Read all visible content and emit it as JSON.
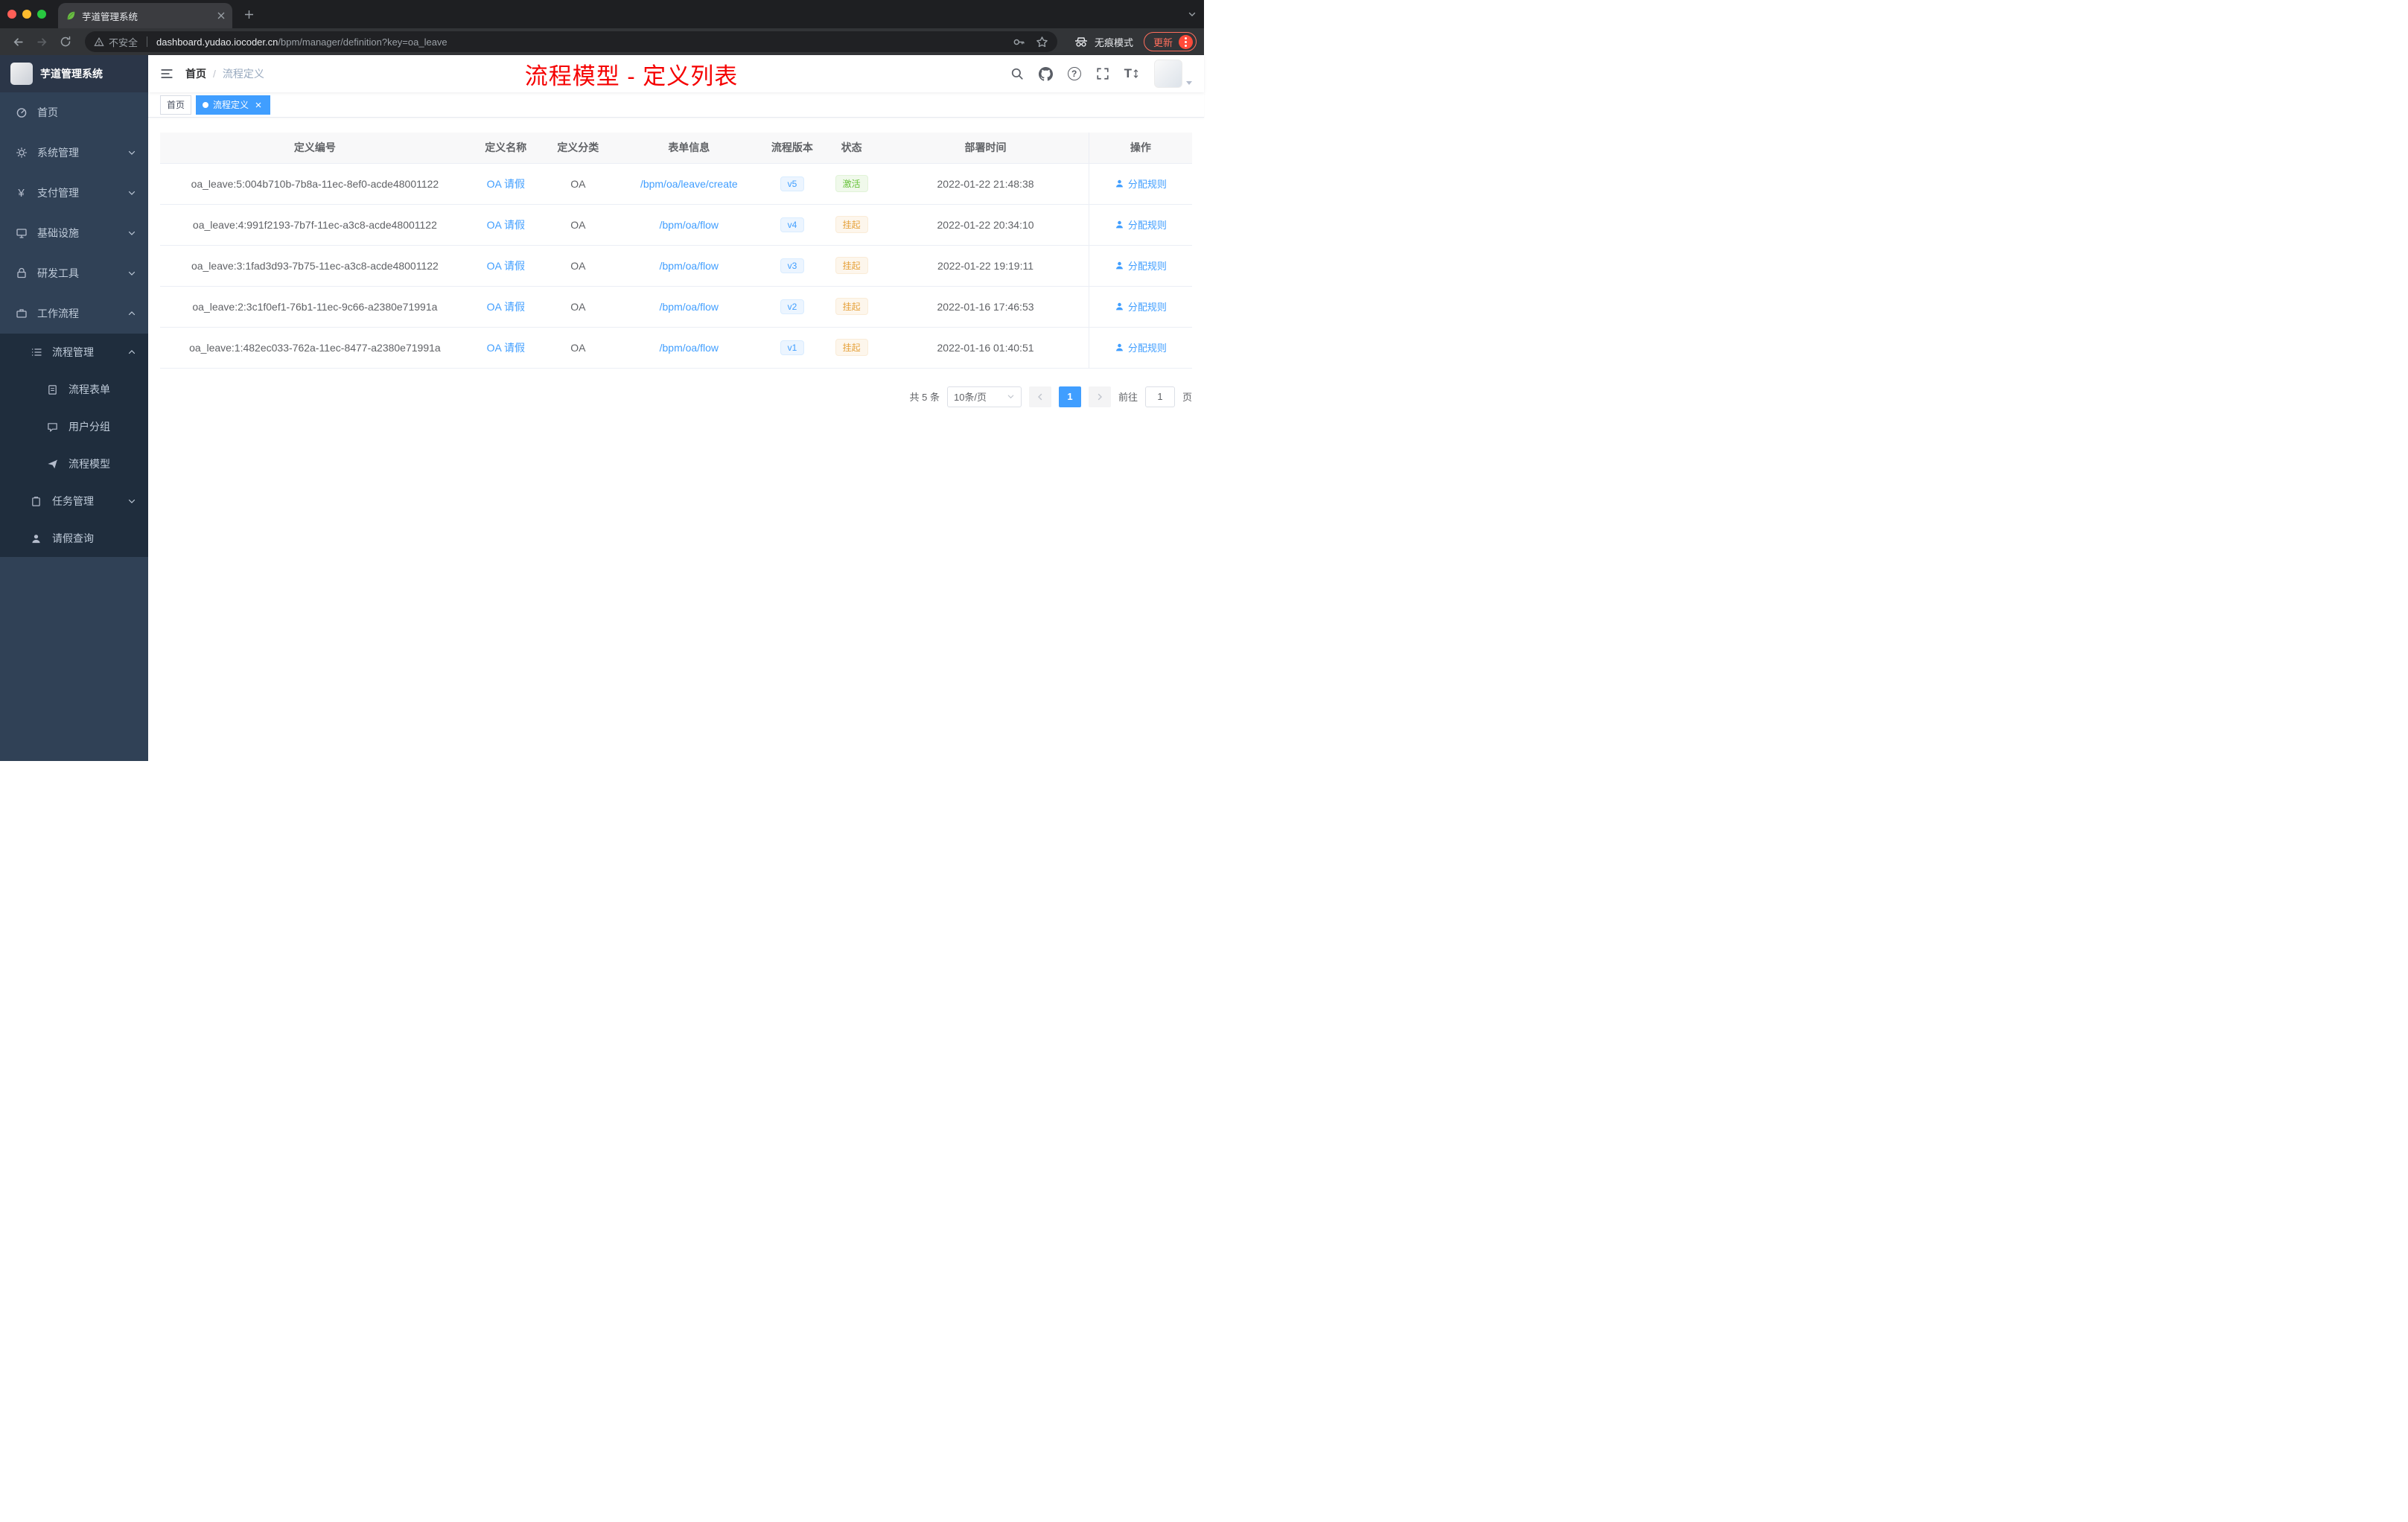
{
  "browser": {
    "tab_title": "芋道管理系统",
    "security_label": "不安全",
    "url_host": "dashboard.yudao.iocoder.cn",
    "url_path": "/bpm/manager/definition?key=oa_leave",
    "incognito_label": "无痕模式",
    "update_label": "更新"
  },
  "icons": {
    "yen": "¥",
    "help": "?",
    "font_size": "T"
  },
  "sidebar": {
    "title": "芋道管理系统",
    "items": [
      {
        "label": "首页"
      },
      {
        "label": "系统管理"
      },
      {
        "label": "支付管理"
      },
      {
        "label": "基础设施"
      },
      {
        "label": "研发工具"
      },
      {
        "label": "工作流程"
      }
    ],
    "sub": {
      "process_mgmt": "流程管理",
      "process_form": "流程表单",
      "user_group": "用户分组",
      "process_model": "流程模型",
      "task_mgmt": "任务管理",
      "leave_query": "请假查询"
    }
  },
  "navbar": {
    "breadcrumb_home": "首页",
    "breadcrumb_sep": "/",
    "breadcrumb_current": "流程定义",
    "annotation": "流程模型 - 定义列表"
  },
  "tags": {
    "home": "首页",
    "active": "流程定义"
  },
  "table": {
    "headers": [
      "定义编号",
      "定义名称",
      "定义分类",
      "表单信息",
      "流程版本",
      "状态",
      "部署时间",
      "操作"
    ],
    "rows": [
      {
        "id": "oa_leave:5:004b710b-7b8a-11ec-8ef0-acde48001122",
        "name": "OA 请假",
        "category": "OA",
        "form": "/bpm/oa/leave/create",
        "version": "v5",
        "status": "激活",
        "status_type": "active",
        "deployed": "2022-01-22 21:48:38",
        "action": "分配规则"
      },
      {
        "id": "oa_leave:4:991f2193-7b7f-11ec-a3c8-acde48001122",
        "name": "OA 请假",
        "category": "OA",
        "form": "/bpm/oa/flow",
        "version": "v4",
        "status": "挂起",
        "status_type": "suspended",
        "deployed": "2022-01-22 20:34:10",
        "action": "分配规则"
      },
      {
        "id": "oa_leave:3:1fad3d93-7b75-11ec-a3c8-acde48001122",
        "name": "OA 请假",
        "category": "OA",
        "form": "/bpm/oa/flow",
        "version": "v3",
        "status": "挂起",
        "status_type": "suspended",
        "deployed": "2022-01-22 19:19:11",
        "action": "分配规则"
      },
      {
        "id": "oa_leave:2:3c1f0ef1-76b1-11ec-9c66-a2380e71991a",
        "name": "OA 请假",
        "category": "OA",
        "form": "/bpm/oa/flow",
        "version": "v2",
        "status": "挂起",
        "status_type": "suspended",
        "deployed": "2022-01-16 17:46:53",
        "action": "分配规则"
      },
      {
        "id": "oa_leave:1:482ec033-762a-11ec-8477-a2380e71991a",
        "name": "OA 请假",
        "category": "OA",
        "form": "/bpm/oa/flow",
        "version": "v1",
        "status": "挂起",
        "status_type": "suspended",
        "deployed": "2022-01-16 01:40:51",
        "action": "分配规则"
      }
    ]
  },
  "pagination": {
    "total": "共 5 条",
    "page_size": "10条/页",
    "current_page": "1",
    "goto_label": "前往",
    "goto_value": "1",
    "goto_unit": "页"
  }
}
